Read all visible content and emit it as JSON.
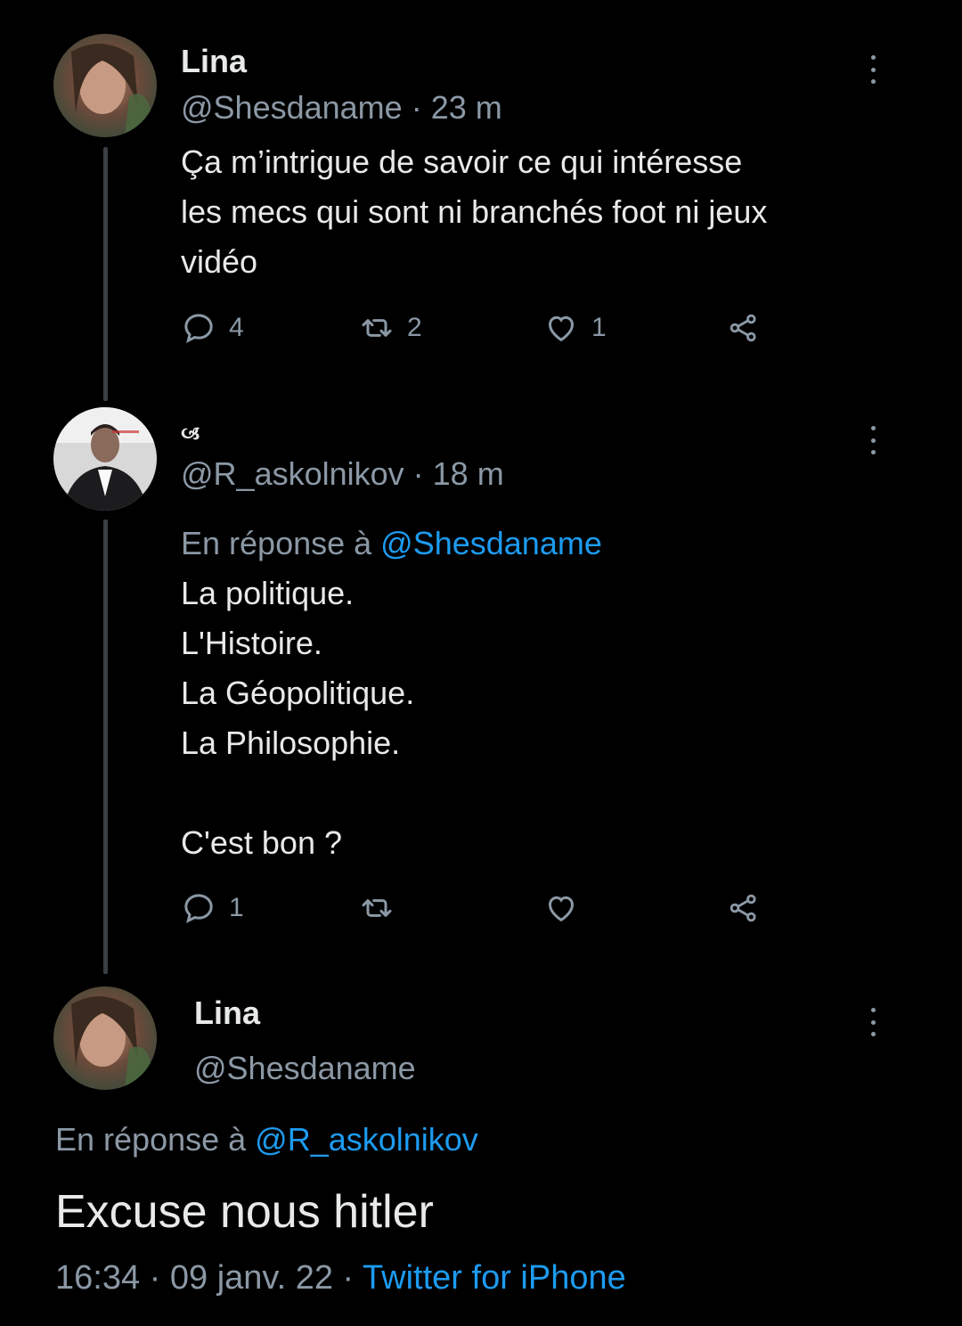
{
  "tweet1": {
    "name": "Lina",
    "handle": "@Shesdaname",
    "sep": " · ",
    "time": "23 m",
    "text_line1": "Ça m’intrigue de savoir ce qui intéresse",
    "text_line2": "les mecs qui sont ni branchés foot ni jeux",
    "text_line3": "vidéo",
    "reply_count": "4",
    "retweet_count": "2",
    "like_count": "1"
  },
  "tweet2": {
    "name": "🙢",
    "handle": "@R_askolnikov",
    "sep": " · ",
    "time": "18 m",
    "reply_prefix": "En réponse à ",
    "reply_to": "@Shesdaname",
    "line1": "La politique.",
    "line2": "L'Histoire.",
    "line3": "La Géopolitique.",
    "line4": "La Philosophie.",
    "line5": "C'est bon ?",
    "reply_count": "1"
  },
  "tweet3": {
    "name": "Lina",
    "handle": "@Shesdaname",
    "reply_prefix": "En réponse à ",
    "reply_to": "@R_askolnikov",
    "text": "Excuse nous hitler",
    "date_time": "16:34 · 09 janv. 22 · ",
    "source": "Twitter for iPhone"
  },
  "colors": {
    "background": "#000000",
    "text": "#e7e9ea",
    "muted": "#8b98a5",
    "link": "#1d9bf0"
  },
  "icons": [
    "reply-icon",
    "retweet-icon",
    "like-icon",
    "share-icon",
    "more-icon"
  ]
}
